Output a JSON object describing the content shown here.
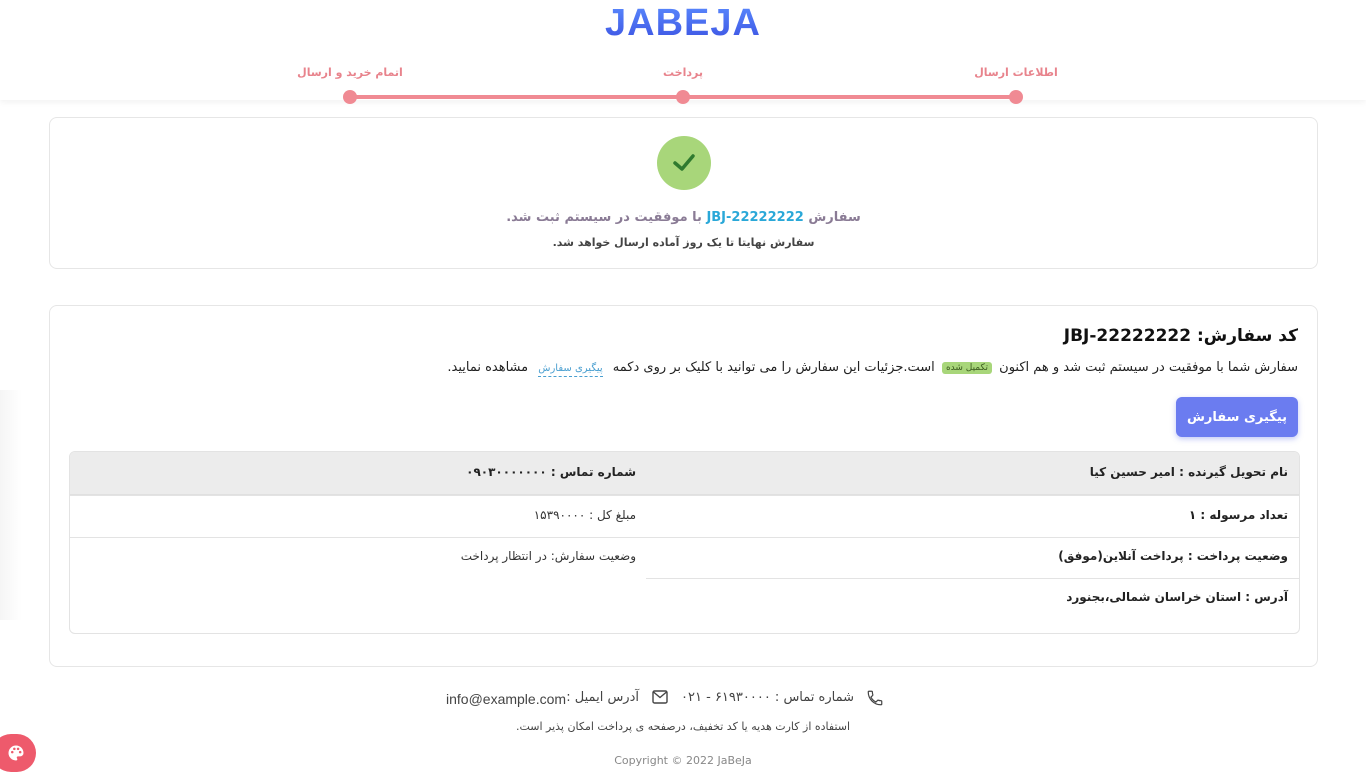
{
  "brand": {
    "logo": "JABEJA"
  },
  "stepper": {
    "steps": [
      {
        "label": "اطلاعات ارسال"
      },
      {
        "label": "پرداخت"
      },
      {
        "label": "اتمام خرید و ارسال"
      }
    ]
  },
  "success": {
    "line1_prefix": "سفارش",
    "order_code": "JBJ-22222222",
    "line1_suffix": "با موفقیت در سیستم ثبت شد.",
    "line2": "سفارش نهایتا تا یک روز آماده ارسال خواهد شد."
  },
  "order": {
    "title": "کد سفارش: JBJ-22222222",
    "desc_part1": "سفارش شما با موفقیت در سیستم ثبت شد و هم اکنون",
    "status_badge": "تکمیل شده",
    "desc_part2": "است.جزئیات این سفارش را می توانید با کلیک بر روی دکمه",
    "track_link": "پیگیری سفارش",
    "desc_part3": "مشاهده نمایید.",
    "track_button": "پیگیری سفارش"
  },
  "details": {
    "recipient": "نام تحویل گیرنده : امیر حسین کیا",
    "phone": "شماره تماس : ۰۹۰۳۰۰۰۰۰۰۰",
    "parcels": "تعداد مرسوله : ۱",
    "total": "مبلغ کل : ۱۵۳۹۰۰۰۰",
    "payment_status": "وضعیت پرداخت : پرداخت آنلاین(موفق)",
    "order_status": "وضعیت سفارش: در انتظار پرداخت",
    "address": "آدرس : استان خراسان شمالی،بجنورد"
  },
  "footer": {
    "phone": "شماره تماس : ۶۱۹۳۰۰۰۰ - ۰۲۱",
    "email_label": "آدرس ایمیل :",
    "email": "info@example.com",
    "note": "استفاده از کارت هدیه یا کد تخفیف، درصفحه ی پرداخت امکان پذیر است.",
    "copyright": "Copyright © 2022 JaBeJa"
  },
  "colors": {
    "accent": "#f08a93",
    "primary_button": "#6b7cf0",
    "success": "#a8d67a",
    "code": "#2aa8d8"
  },
  "icons": [
    "check-icon",
    "phone-icon",
    "mail-icon",
    "palette-icon"
  ]
}
